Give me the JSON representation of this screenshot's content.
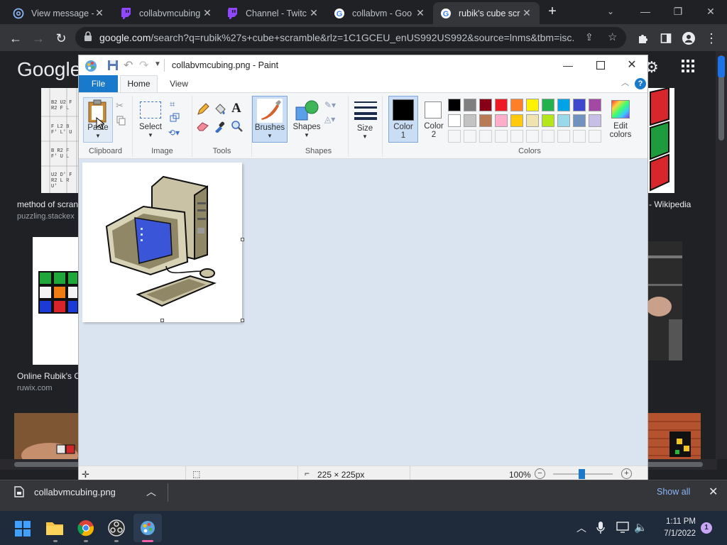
{
  "browser": {
    "tabs": [
      {
        "label": "View message -",
        "icon": "at-icon"
      },
      {
        "label": "collabvmcubing",
        "icon": "twitch-icon"
      },
      {
        "label": "Channel - Twitc",
        "icon": "twitch-icon"
      },
      {
        "label": "collabvm - Goo",
        "icon": "google-icon"
      },
      {
        "label": "rubik's cube scr",
        "icon": "google-icon"
      }
    ],
    "url_host": "google.com",
    "url_path": "/search?q=rubik%27s+cube+scramble&rlz=1C1GCEU_enUS992US992&source=lnms&tbm=isc..."
  },
  "google": {
    "logo": "Google",
    "results": [
      {
        "caption": "method of scran",
        "source": "puzzling.stackex"
      },
      {
        "caption": "- Wikipedia",
        "source": ""
      },
      {
        "caption": "Online Rubik's C",
        "source": "ruwix.com"
      }
    ],
    "thumb_rows": [
      [
        "B2 U2 F1",
        "R2 F L",
        "F L2 B2",
        "F' L' U'",
        "B R2 F1",
        "F' U L",
        "U2 D' F",
        "R2 L R1",
        "U'"
      ]
    ]
  },
  "paint": {
    "title": "collabvmcubing.png - Paint",
    "tabs": {
      "file": "File",
      "home": "Home",
      "view": "View"
    },
    "groups": {
      "clipboard": "Clipboard",
      "image": "Image",
      "tools": "Tools",
      "shapes": "Shapes",
      "colors": "Colors"
    },
    "labels": {
      "paste": "Paste",
      "select": "Select",
      "brushes": "Brushes",
      "shapes": "Shapes",
      "size": "Size",
      "color1": "Color\n1",
      "color1_a": "Color",
      "color1_b": "1",
      "color2_a": "Color",
      "color2_b": "2",
      "edit_colors_a": "Edit",
      "edit_colors_b": "colors"
    },
    "palette_row1": [
      "#000000",
      "#7f7f7f",
      "#880015",
      "#ed1c24",
      "#ff7f27",
      "#fff200",
      "#22b14c",
      "#00a2e8",
      "#3f48cc",
      "#a349a4"
    ],
    "palette_row2": [
      "#ffffff",
      "#c3c3c3",
      "#b97a57",
      "#ffaec9",
      "#ffc90e",
      "#efe4b0",
      "#b5e61d",
      "#99d9ea",
      "#7092be",
      "#c8bfe7"
    ],
    "status": {
      "size": "225 × 225px",
      "zoom": "100%"
    }
  },
  "download": {
    "filename": "collabvmcubing.png",
    "show_all": "Show all"
  },
  "taskbar": {
    "time": "1:11 PM",
    "date": "7/1/2022",
    "notifications": "1"
  }
}
